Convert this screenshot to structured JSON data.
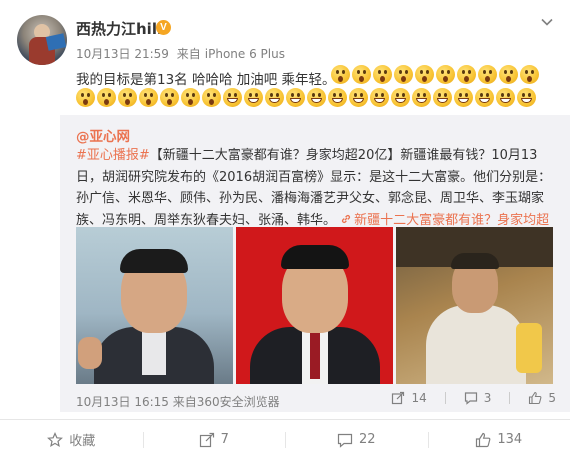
{
  "post": {
    "username": "西热力江hill",
    "verified_badge": "V",
    "time": "10月13日 21:59",
    "source_prefix": "来自",
    "source": "iPhone 6 Plus",
    "text": "我的目标是第13名 哈哈哈 加油吧 乘年轻。",
    "emoji_row1": [
      "shock",
      "shock",
      "shock",
      "shock",
      "shock",
      "shock",
      "shock",
      "shock",
      "shock",
      "shock"
    ],
    "emoji_row2": [
      "shock",
      "shock",
      "shock",
      "shock",
      "shock",
      "shock",
      "shock",
      "grin",
      "grin",
      "grin",
      "grin",
      "grin",
      "grin",
      "grin",
      "grin",
      "grin",
      "grin",
      "grin",
      "grin",
      "grin",
      "grin",
      "grin"
    ],
    "menu_icon": "chevron-down-icon"
  },
  "repost": {
    "author": "@亚心网",
    "tag": "#亚心播报#",
    "headline": "【新疆十二大富豪都有谁？身家均超20亿】",
    "body": "新疆谁最有钱？10月13日，胡润研究院发布的《2016胡润百富榜》显示：是这十二大富豪。他们分别是：孙广信、米恩华、顾伟、孙为民、潘梅海潘艺尹父女、郭念昆、周卫华、李玉瑚家族、冯东明、周举东狄春夫妇、张涌、韩华。",
    "link_icon": "link-icon",
    "link_text": "新疆十二大富豪都有谁？身家均超20亿",
    "time": "10月13日 16:15",
    "source_prefix": "来自",
    "source": "360安全浏览器",
    "forward_count": "14",
    "comment_count": "3",
    "like_count": "5"
  },
  "actions": {
    "favorite_label": "收藏",
    "forward_count": "7",
    "comment_count": "22",
    "like_count": "134"
  },
  "colors": {
    "accent": "#eb7350",
    "badge": "#f5a623",
    "repost_bg": "#f2f2f5",
    "muted_text": "#808080"
  }
}
